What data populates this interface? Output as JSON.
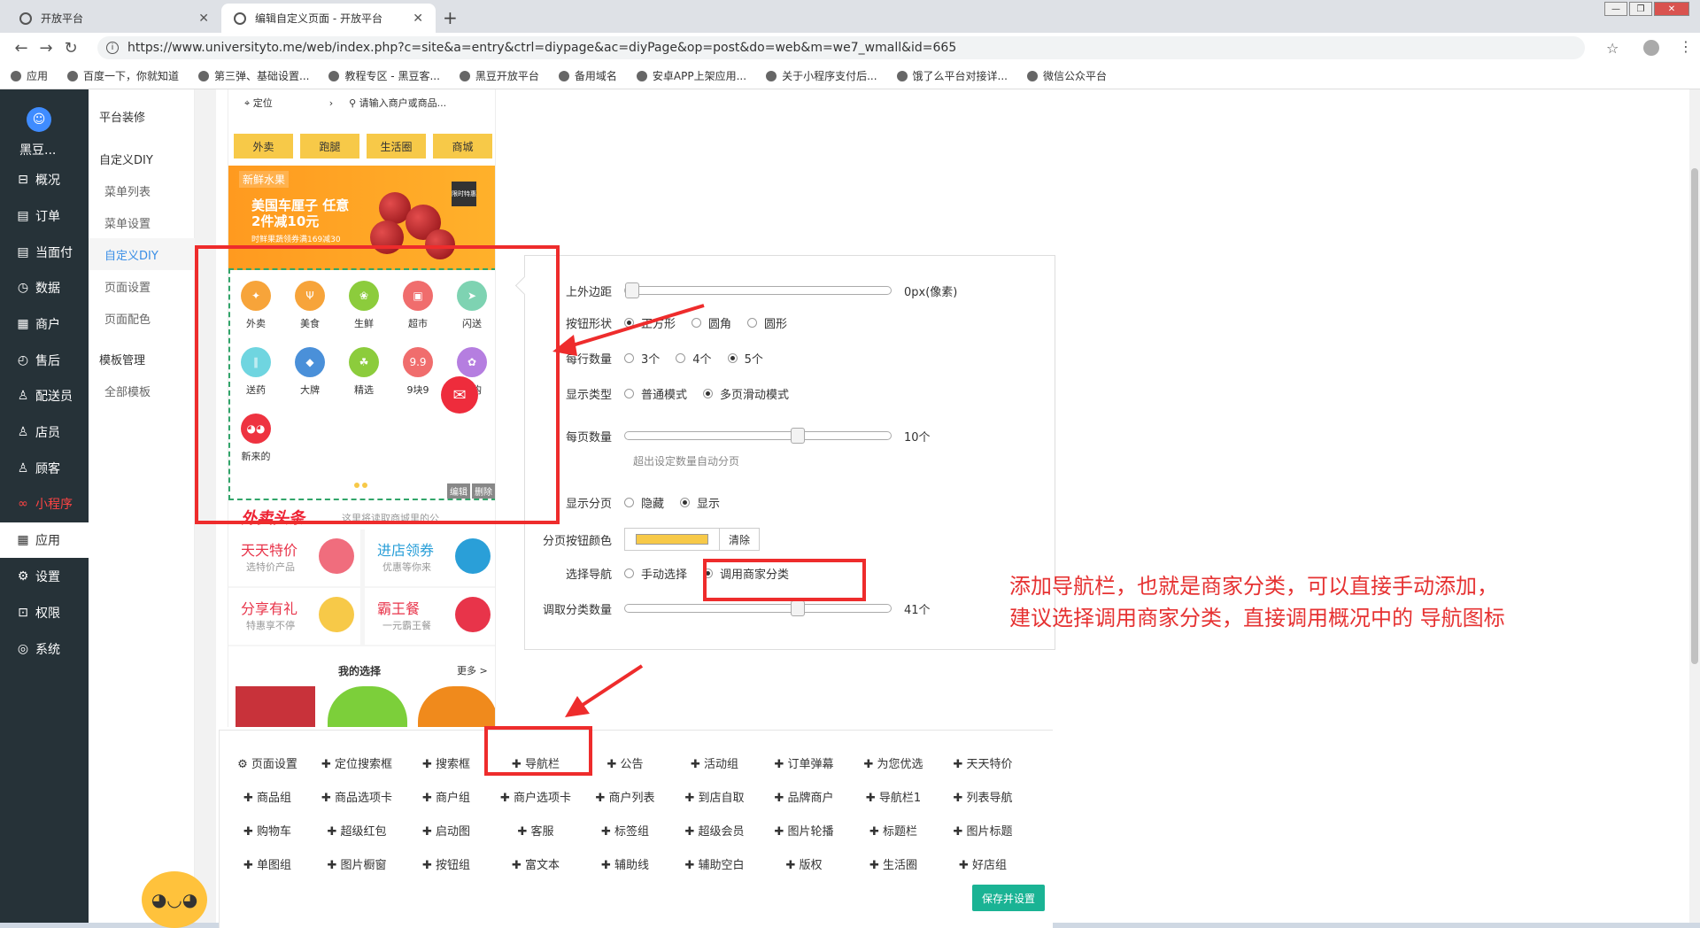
{
  "browser": {
    "tabs": [
      {
        "title": "开放平台"
      },
      {
        "title": "编辑自定义页面 - 开放平台"
      }
    ],
    "url": "https://www.universityto.me/web/index.php?c=site&a=entry&ctrl=diypage&ac=diyPage&op=post&do=web&m=we7_wmall&id=665",
    "bookmarks": [
      "应用",
      "百度一下，你就知道",
      "第三弹、基础设置...",
      "教程专区 - 黑豆客...",
      "黑豆开放平台",
      "备用域名",
      "安卓APP上架应用...",
      "关于小程序支付后...",
      "饿了么平台对接详...",
      "微信公众平台"
    ]
  },
  "sidebar": {
    "app_name": "黑豆...",
    "items": [
      {
        "label": "概况",
        "icon": "⊟"
      },
      {
        "label": "订单",
        "icon": "▤"
      },
      {
        "label": "当面付",
        "icon": "▤"
      },
      {
        "label": "数据",
        "icon": "◷"
      },
      {
        "label": "商户",
        "icon": "▦"
      },
      {
        "label": "售后",
        "icon": "◴"
      },
      {
        "label": "配送员",
        "icon": "♙"
      },
      {
        "label": "店员",
        "icon": "♙"
      },
      {
        "label": "顾客",
        "icon": "♙"
      },
      {
        "label": "小程序",
        "icon": "∞"
      },
      {
        "label": "应用",
        "icon": "▦"
      },
      {
        "label": "设置",
        "icon": "⚙"
      },
      {
        "label": "权限",
        "icon": "⊡"
      },
      {
        "label": "系统",
        "icon": "◎"
      }
    ]
  },
  "subnav": {
    "items": [
      {
        "label": "平台装修",
        "kind": "grp"
      },
      {
        "label": "自定义DIY",
        "kind": "grp"
      },
      {
        "label": "菜单列表",
        "kind": "sub"
      },
      {
        "label": "菜单设置",
        "kind": "sub"
      },
      {
        "label": "自定义DIY",
        "kind": "sub"
      },
      {
        "label": "页面设置",
        "kind": "sub"
      },
      {
        "label": "页面配色",
        "kind": "sub"
      },
      {
        "label": "模板管理",
        "kind": "grp"
      },
      {
        "label": "全部模板",
        "kind": "sub"
      }
    ]
  },
  "preview": {
    "location": "定位",
    "search_placeholder": "请输入商户或商品...",
    "quick_tabs": [
      "外卖",
      "跑腿",
      "生活圈",
      "商城"
    ],
    "banner": {
      "tag": "新鲜水果",
      "title": "美国车厘子 任意2件减10元",
      "subtitle": "时鲜果蔬领券满169减30",
      "badge": "限时特惠"
    },
    "nav_items": [
      {
        "label": "外卖",
        "color": "#f7a43a",
        "glyph": "✦"
      },
      {
        "label": "美食",
        "color": "#f7a43a",
        "glyph": "Ψ"
      },
      {
        "label": "生鲜",
        "color": "#8ccc3c",
        "glyph": "❀"
      },
      {
        "label": "超市",
        "color": "#f06d6d",
        "glyph": "▣"
      },
      {
        "label": "闪送",
        "color": "#7ed3b2",
        "glyph": "➤"
      },
      {
        "label": "送药",
        "color": "#6fd5e0",
        "glyph": "∥"
      },
      {
        "label": "大牌",
        "color": "#4a90d9",
        "glyph": "◆"
      },
      {
        "label": "精选",
        "color": "#8ccc3c",
        "glyph": "☘"
      },
      {
        "label": "9块9",
        "color": "#f06d6d",
        "glyph": "9.9"
      },
      {
        "label": "团购",
        "color": "#b57ee0",
        "glyph": "✿"
      },
      {
        "label": "新来的",
        "color": "#ee3340",
        "glyph": "◕◕"
      }
    ],
    "edit_label": "编辑",
    "delete_label": "删除",
    "promo_title": "外卖头条",
    "promo_desc": "这里将读取商城里的公",
    "promos": [
      {
        "title": "天天特价",
        "sub": "选特价产品",
        "color": "#e8344a",
        "icon_color": "#f06d7d"
      },
      {
        "title": "进店领券",
        "sub": "优惠等你来",
        "color": "#2a9fd8",
        "icon_color": "#2a9fd8"
      },
      {
        "title": "分享有礼",
        "sub": "特惠享不停",
        "color": "#e8344a",
        "icon_color": "#f7c948"
      },
      {
        "title": "霸王餐",
        "sub": "一元霸王餐",
        "color": "#e8344a",
        "icon_color": "#e8344a"
      }
    ],
    "my_choice": "我的选择",
    "more": "更多 >"
  },
  "settings": {
    "margin_label": "上外边距",
    "margin_value": "0px(像素)",
    "margin_level": 0,
    "shape_label": "按钮形状",
    "shape_options": [
      "正方形",
      "圆角",
      "圆形"
    ],
    "shape_selected": 0,
    "per_row_label": "每行数量",
    "per_row_options": [
      "3个",
      "4个",
      "5个"
    ],
    "per_row_selected": 2,
    "display_type_label": "显示类型",
    "display_type_options": [
      "普通模式",
      "多页滑动模式"
    ],
    "display_type_selected": 1,
    "per_page_label": "每页数量",
    "per_page_value": "10个",
    "per_page_level": 0.66,
    "per_page_hint": "超出设定数量自动分页",
    "show_page_label": "显示分页",
    "show_page_options": [
      "隐藏",
      "显示"
    ],
    "show_page_selected": 1,
    "page_btn_color_label": "分页按钮颜色",
    "page_btn_color": "#f7c948",
    "clear_label": "清除",
    "select_nav_label": "选择导航",
    "select_nav_options": [
      "手动选择",
      "调用商家分类"
    ],
    "select_nav_selected": 1,
    "fetch_count_label": "调取分类数量",
    "fetch_count_value": "41个",
    "fetch_count_level": 0.66
  },
  "annotation": {
    "line1": "添加导航栏，也就是商家分类，可以直接手动添加，",
    "line2": "建议选择调用商家分类，直接调用概况中的 导航图标"
  },
  "palette": {
    "rows": [
      [
        "⚙ 页面设置",
        "✚ 定位搜索框",
        "✚ 搜索框",
        "✚ 导航栏",
        "✚ 公告",
        "✚ 活动组",
        "✚ 订单弹幕",
        "✚ 为您优选",
        "✚ 天天特价"
      ],
      [
        "✚ 商品组",
        "✚ 商品选项卡",
        "✚ 商户组",
        "✚ 商户选项卡",
        "✚ 商户列表",
        "✚ 到店自取",
        "✚ 品牌商户",
        "✚ 导航栏1",
        "✚ 列表导航"
      ],
      [
        "✚ 购物车",
        "✚ 超级红包",
        "✚ 启动图",
        "✚ 客服",
        "✚ 标签组",
        "✚ 超级会员",
        "✚ 图片轮播",
        "✚ 标题栏",
        "✚ 图片标题"
      ],
      [
        "✚ 单图组",
        "✚ 图片橱窗",
        "✚ 按钮组",
        "✚ 富文本",
        "✚ 辅助线",
        "✚ 辅助空白",
        "✚ 版权",
        "✚ 生活圈",
        "✚ 好店组"
      ]
    ],
    "save_label": "保存并设置"
  },
  "colors": {
    "sidebar_bg": "#263238",
    "accent_yellow": "#f7c948",
    "annotation_red": "#ee2c2c",
    "save_green": "#1ab394"
  }
}
